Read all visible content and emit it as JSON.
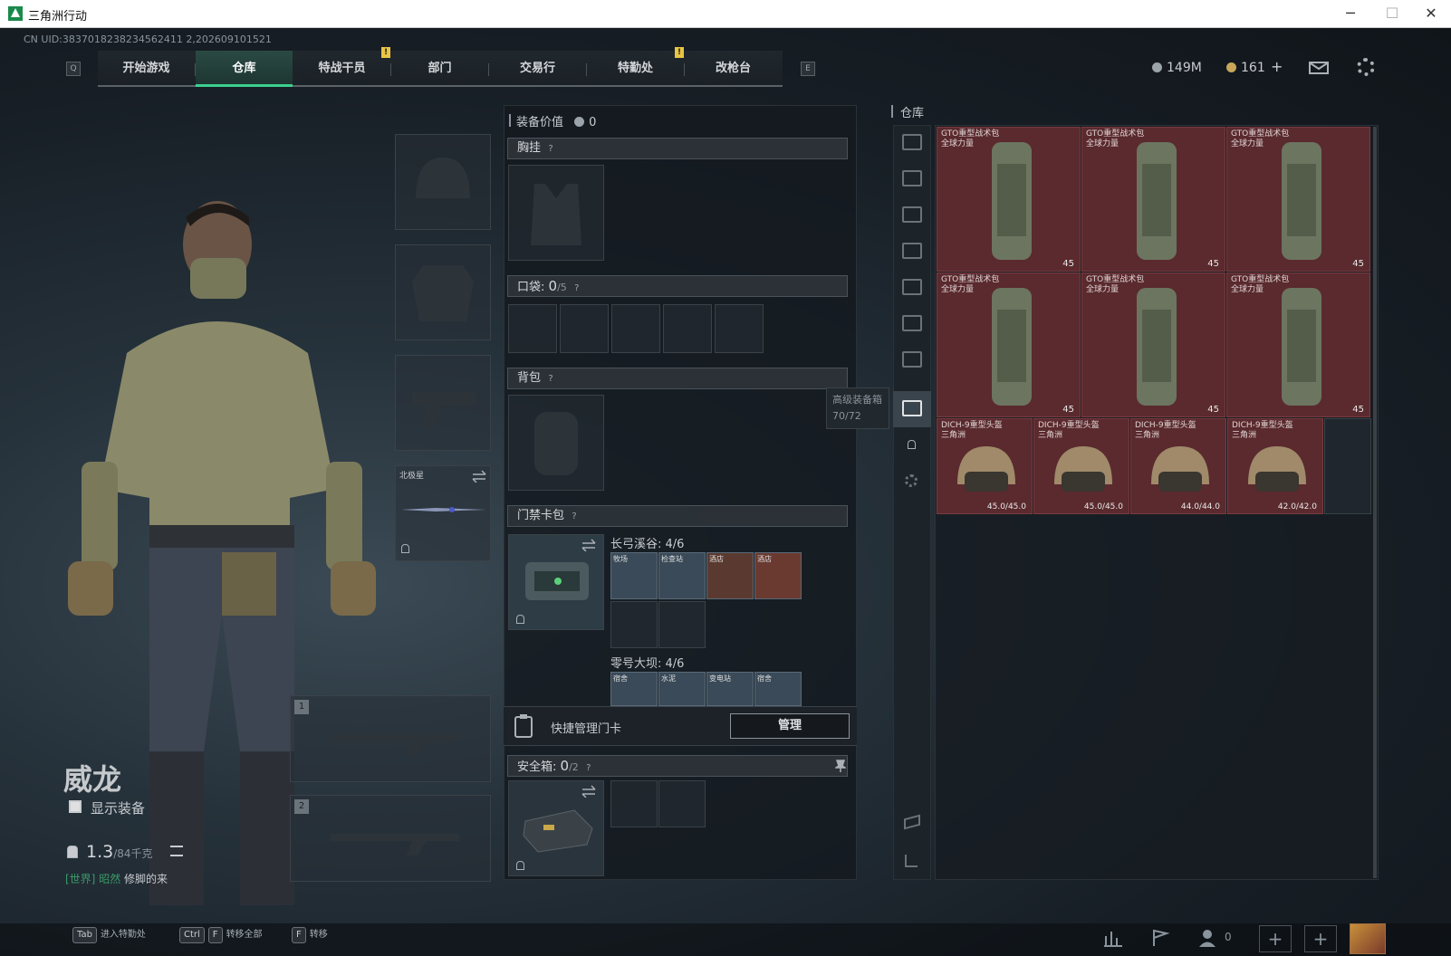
{
  "window": {
    "title": "三角洲行动",
    "minimize": "─",
    "maximize": "☐",
    "close": "✕"
  },
  "uid": "CN UID:3837018238234562411 2,202609101521",
  "nav": {
    "left_key": "Q",
    "right_key": "E",
    "tabs": [
      "开始游戏",
      "仓库",
      "特战干员",
      "部门",
      "交易行",
      "特勤处",
      "改枪台"
    ],
    "active": "仓库",
    "notif_mark": "!"
  },
  "currency": {
    "silver": "149M",
    "gold": "161",
    "add": "+"
  },
  "header_icons": [
    "mail-icon",
    "settings-icon"
  ],
  "character": {
    "name": "威龙",
    "show_equipment": "显示装备",
    "weight": "1.3",
    "weight_cap": "/84千克",
    "chat_channel": "[世界]",
    "chat_user": "昭然",
    "chat_text": "修脚的来"
  },
  "gear_slots": {
    "melee_name": "北极星",
    "weapon1_num": "1",
    "weapon2_num": "2"
  },
  "equip_panel": {
    "value_label": "装备价值",
    "value": "0",
    "chest_label": "胸挂",
    "pocket_label": "口袋:",
    "pocket_used": "0",
    "pocket_total": "/5",
    "backpack_label": "背包",
    "keycard_label": "门禁卡包",
    "q_mark": "?",
    "map1_name": "长弓溪谷:",
    "map1_count": "4/6",
    "map1_cards": [
      "牧场",
      "检查站",
      "酒店",
      "酒店"
    ],
    "map2_name": "零号大坝:",
    "map2_count": "4/6",
    "map2_cards": [
      "宿舍",
      "水泥",
      "变电站",
      "宿舍"
    ],
    "quick_manage": "快捷管理门卡",
    "manage_btn": "管理",
    "safebox_label": "安全箱:",
    "safebox_used": "0",
    "safebox_total": "/2"
  },
  "storage": {
    "title": "仓库",
    "tooltip_title": "高级装备箱",
    "tooltip_value": "70/72",
    "backpacks": [
      {
        "name": "GTO重型战术包",
        "sub": "全球力量",
        "value": "45"
      },
      {
        "name": "GTO重型战术包",
        "sub": "全球力量",
        "value": "45"
      },
      {
        "name": "GTO重型战术包",
        "sub": "全球力量",
        "value": "45"
      },
      {
        "name": "GTO重型战术包",
        "sub": "全球力量",
        "value": "45"
      },
      {
        "name": "GTO重型战术包",
        "sub": "全球力量",
        "value": "45"
      },
      {
        "name": "GTO重型战术包",
        "sub": "全球力量",
        "value": "45"
      }
    ],
    "helmets": [
      {
        "name": "DICH-9重型头盔",
        "sub": "三角洲",
        "value": "45.0/45.0"
      },
      {
        "name": "DICH-9重型头盔",
        "sub": "三角洲",
        "value": "45.0/45.0"
      },
      {
        "name": "DICH-9重型头盔",
        "sub": "三角洲",
        "value": "44.0/44.0"
      },
      {
        "name": "DICH-9重型头盔",
        "sub": "三角洲",
        "value": "42.0/42.0"
      }
    ]
  },
  "bottom": {
    "hint1_key": "Tab",
    "hint1": "进入特勤处",
    "hint2_key1": "Ctrl",
    "hint2_key2": "F",
    "hint2": "转移全部",
    "hint3_key": "F",
    "hint3": "转移",
    "friends": "0",
    "add": "+"
  },
  "colors": {
    "accent": "#3ccf8e",
    "storage_item": "#5a2a2e",
    "notif": "#e8c542"
  }
}
